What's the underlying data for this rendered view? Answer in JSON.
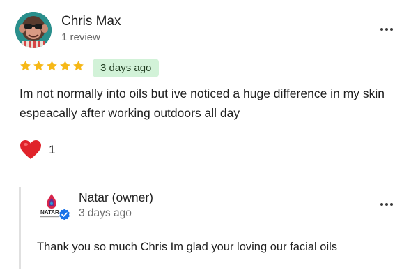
{
  "review": {
    "reviewer_name": "Chris Max",
    "review_count": "1 review",
    "rating": 5,
    "rating_max": 5,
    "time_ago": "3 days ago",
    "text": "Im not normally into oils but ive noticed a huge difference in my skin espeacally after working outdoors all day",
    "reaction_icon": "heart-icon",
    "reaction_count": "1"
  },
  "reply": {
    "owner_name": "Natar (owner)",
    "time_ago": "3 days ago",
    "logo_text": "NATAR",
    "text": "Thank you so much Chris Im glad your loving our facial oils"
  },
  "colors": {
    "star": "#f6b817",
    "badge_bg": "#d2f2d8",
    "heart": "#e0232a",
    "verified": "#1a73e8"
  }
}
